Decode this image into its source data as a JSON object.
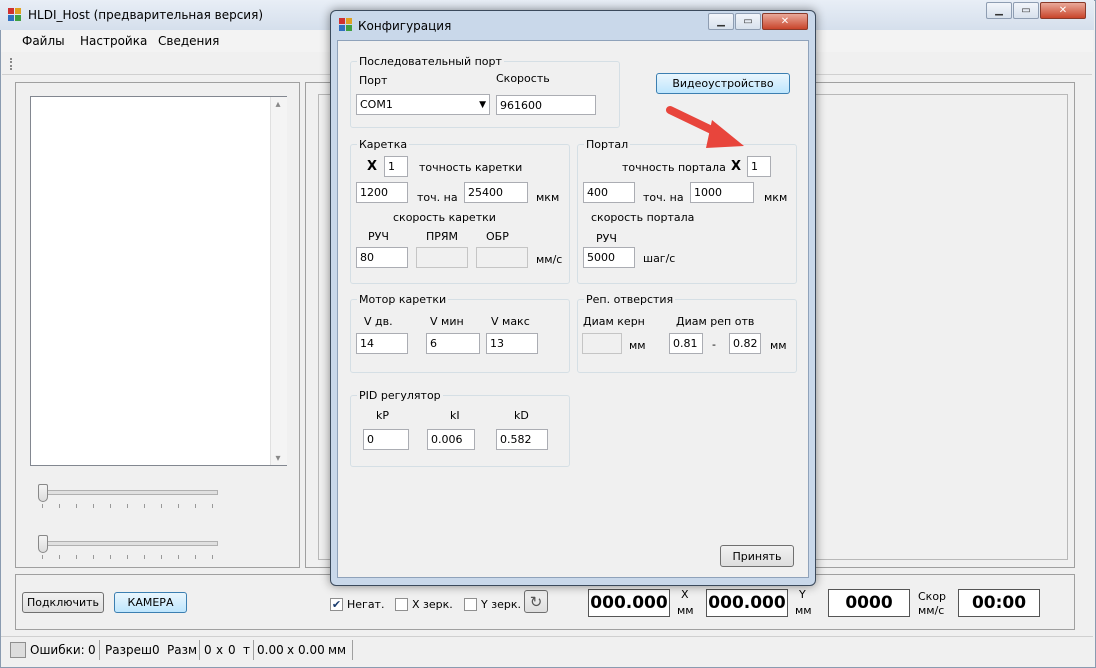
{
  "main": {
    "title": "HLDI_Host (предварительная версия)",
    "menu": [
      "Файлы",
      "Настройка",
      "Сведения"
    ]
  },
  "bottom": {
    "connect_label": "Подключить",
    "camera_label": "КАМЕРА",
    "negative_label": "Негат.",
    "negative_checked": true,
    "xmirror_label": "X зерк.",
    "ymirror_label": "Y зерк.",
    "x_value": "000.000",
    "x_unit_top": "X",
    "x_unit_bottom": "мм",
    "y_value": "000.000",
    "y_unit_top": "Y",
    "y_unit_bottom": "мм",
    "speed_value": "0000",
    "speed_label_top": "Скор",
    "speed_label_bottom": "мм/с",
    "time_value": "00:00"
  },
  "status": {
    "errors_label": "Ошибки:",
    "errors_value": "0",
    "res_label": "Разреш",
    "res_value": "0",
    "size_label": "Разм",
    "size_w": "0",
    "size_x1": "x",
    "size_h": "0",
    "t_label": "т",
    "t_a": "0.00",
    "t_x": "x",
    "t_b": "0.00",
    "t_unit": "мм"
  },
  "dialog": {
    "title": "Конфигурация",
    "serial": {
      "group": "Последовательный порт",
      "port_label": "Порт",
      "port_value": "COM1",
      "speed_label": "Скорость",
      "speed_value": "961600"
    },
    "video_button": "Видеоустройство",
    "carriage": {
      "group": "Каретка",
      "x_label": "X",
      "mult": "1",
      "precision_label": "точность каретки",
      "pts": "1200",
      "pts_on": "точ. на",
      "um": "25400",
      "um_label": "мкм",
      "speed_label": "скорость каретки",
      "manual_label": "РУЧ",
      "forward_label": "ПРЯМ",
      "reverse_label": "ОБР",
      "manual_value": "80",
      "forward_value": "",
      "reverse_value": "",
      "unit": "мм/с"
    },
    "portal": {
      "group": "Портал",
      "precision_label": "точность портала",
      "x_label": "X",
      "mult": "1",
      "pts": "400",
      "pts_on": "точ. на",
      "um": "1000",
      "um_label": "мкм",
      "speed_label": "скорость портала",
      "manual_label": "РУЧ",
      "manual_value": "5000",
      "unit": "шаг/с"
    },
    "motor": {
      "group": "Мотор каретки",
      "vdv_label": "V дв.",
      "vmin_label": "V мин",
      "vmax_label": "V макс",
      "vdv": "14",
      "vmin": "6",
      "vmax": "13"
    },
    "holes": {
      "group": "Реп. отверстия",
      "core_label": "Диам керн",
      "hole_label": "Диам реп отв",
      "core_value": "",
      "mm1": "мм",
      "min": "0.81",
      "dash": "-",
      "max": "0.82",
      "mm2": "мм"
    },
    "pid": {
      "group": "PID регулятор",
      "kp_label": "kP",
      "ki_label": "kI",
      "kd_label": "kD",
      "kp": "0",
      "ki": "0.006",
      "kd": "0.582"
    },
    "accept_button": "Принять"
  },
  "colors": {
    "arrow": "#e8453c",
    "dialog_frame": "#c9d8ea"
  }
}
